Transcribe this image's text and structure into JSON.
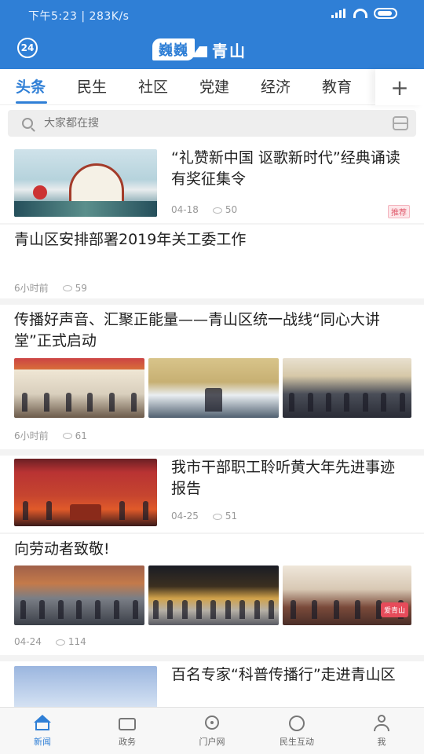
{
  "statusbar": {
    "time_speed": "下午5:23 | 283K/s"
  },
  "header": {
    "date_badge": "24",
    "logo_box": "巍巍",
    "logo_text": "青山"
  },
  "tabs": [
    {
      "label": "头条",
      "active": true
    },
    {
      "label": "民生"
    },
    {
      "label": "社区"
    },
    {
      "label": "党建"
    },
    {
      "label": "经济"
    },
    {
      "label": "教育"
    }
  ],
  "tab_plus": "+",
  "search": {
    "placeholder": "大家都在搜"
  },
  "feed": {
    "items": [
      {
        "title": "“礼赞新中国 讴歌新时代”经典诵读有奖征集令",
        "date": "04-18",
        "views": "50",
        "tag": "推荐"
      },
      {
        "title": "青山区安排部署2019年关工委工作",
        "date": "6小时前",
        "views": "59"
      },
      {
        "title": "传播好声音、汇聚正能量——青山区统一战线“同心大讲堂”正式启动",
        "date": "6小时前",
        "views": "61"
      },
      {
        "title": "我市干部职工聆听黄大年先进事迹报告",
        "date": "04-25",
        "views": "51"
      },
      {
        "title": "向劳动者致敬!",
        "date": "04-24",
        "views": "114",
        "watermark": "爱青山"
      },
      {
        "title": "百名专家“科普传播行”走进青山区"
      }
    ]
  },
  "bottomnav": [
    {
      "label": "新闻",
      "icon": "home-icon",
      "active": true
    },
    {
      "label": "政务",
      "icon": "government-icon"
    },
    {
      "label": "门户网",
      "icon": "portal-icon"
    },
    {
      "label": "民生互动",
      "icon": "interaction-icon"
    },
    {
      "label": "我",
      "icon": "me-icon"
    }
  ],
  "colors": {
    "brand": "#2f7fd6",
    "tag": "#e05a6c"
  }
}
